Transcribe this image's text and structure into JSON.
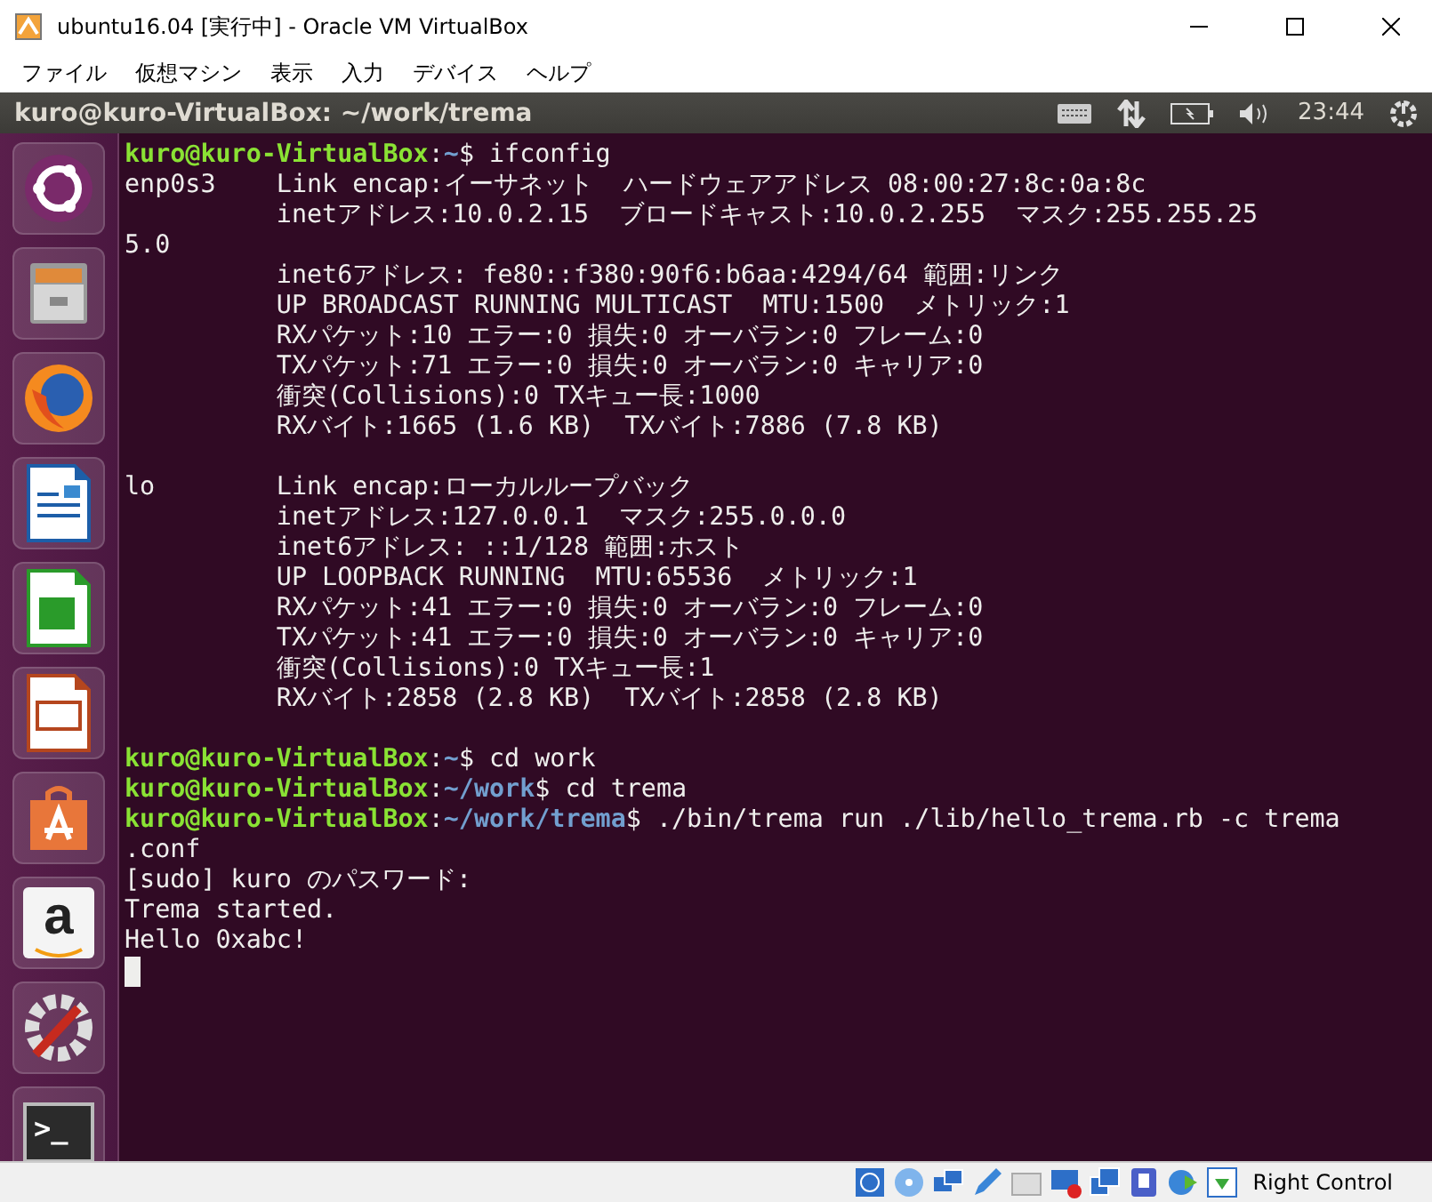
{
  "window": {
    "title": "ubuntu16.04 [実行中] - Oracle VM VirtualBox"
  },
  "menu": [
    "ファイル",
    "仮想マシン",
    "表示",
    "入力",
    "デバイス",
    "ヘルプ"
  ],
  "topbar": {
    "title": "kuro@kuro-VirtualBox: ~/work/trema",
    "clock": "23:44"
  },
  "launcher": [
    {
      "kind": "ubuntu"
    },
    {
      "kind": "files"
    },
    {
      "kind": "browser"
    },
    {
      "kind": "writer"
    },
    {
      "kind": "calc"
    },
    {
      "kind": "impress"
    },
    {
      "kind": "store"
    },
    {
      "kind": "amazon",
      "glyph": "a"
    },
    {
      "kind": "settings"
    },
    {
      "kind": "terminal",
      "glyph": ">_"
    }
  ],
  "terminal": {
    "blocks": [
      [
        {
          "kind": "prompt",
          "user": "kuro@kuro-VirtualBox",
          "colon": ":",
          "path": "~",
          "command": "$ ifconfig"
        },
        {
          "kind": "output",
          "text": "enp0s3    Link encap:イーサネット  ハードウェアアドレス 08:00:27:8c:0a:8c"
        },
        {
          "kind": "output",
          "text": "          inetアドレス:10.0.2.15  ブロードキャスト:10.0.2.255  マスク:255.255.25"
        },
        {
          "kind": "output",
          "text": "5.0"
        },
        {
          "kind": "output",
          "text": "          inet6アドレス: fe80::f380:90f6:b6aa:4294/64 範囲:リンク"
        },
        {
          "kind": "output",
          "text": "          UP BROADCAST RUNNING MULTICAST  MTU:1500  メトリック:1"
        },
        {
          "kind": "output",
          "text": "          RXパケット:10 エラー:0 損失:0 オーバラン:0 フレーム:0"
        },
        {
          "kind": "output",
          "text": "          TXパケット:71 エラー:0 損失:0 オーバラン:0 キャリア:0"
        },
        {
          "kind": "output",
          "text": "          衝突(Collisions):0 TXキュー長:1000"
        },
        {
          "kind": "output",
          "text": "          RXバイト:1665 (1.6 KB)  TXバイト:7886 (7.8 KB)"
        }
      ],
      [
        {
          "kind": "output",
          "text": "lo        Link encap:ローカルループバック"
        },
        {
          "kind": "output",
          "text": "          inetアドレス:127.0.0.1  マスク:255.0.0.0"
        },
        {
          "kind": "output",
          "text": "          inet6アドレス: ::1/128 範囲:ホスト"
        },
        {
          "kind": "output",
          "text": "          UP LOOPBACK RUNNING  MTU:65536  メトリック:1"
        },
        {
          "kind": "output",
          "text": "          RXパケット:41 エラー:0 損失:0 オーバラン:0 フレーム:0"
        },
        {
          "kind": "output",
          "text": "          TXパケット:41 エラー:0 損失:0 オーバラン:0 キャリア:0"
        },
        {
          "kind": "output",
          "text": "          衝突(Collisions):0 TXキュー長:1"
        },
        {
          "kind": "output",
          "text": "          RXバイト:2858 (2.8 KB)  TXバイト:2858 (2.8 KB)"
        }
      ],
      [
        {
          "kind": "prompt",
          "user": "kuro@kuro-VirtualBox",
          "colon": ":",
          "path": "~",
          "command": "$ cd work"
        },
        {
          "kind": "prompt",
          "user": "kuro@kuro-VirtualBox",
          "colon": ":",
          "path": "~/work",
          "command": "$ cd trema"
        },
        {
          "kind": "prompt",
          "user": "kuro@kuro-VirtualBox",
          "colon": ":",
          "path": "~/work/trema",
          "command": "$ ./bin/trema run ./lib/hello_trema.rb -c trema"
        },
        {
          "kind": "output",
          "text": ".conf"
        },
        {
          "kind": "output",
          "text": "[sudo] kuro のパスワード:"
        },
        {
          "kind": "output",
          "text": "Trema started."
        },
        {
          "kind": "output",
          "text": "Hello 0xabc!"
        }
      ]
    ]
  },
  "status_bar": {
    "host_key": "Right Control"
  }
}
